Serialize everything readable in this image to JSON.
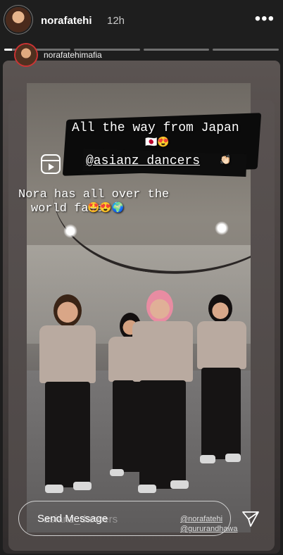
{
  "header": {
    "username": "norafatehi",
    "time_ago": "12h",
    "more_icon": "more-horizontal-icon",
    "progress": {
      "segments": 4,
      "active_index": 0,
      "active_fill_fraction": 0.12
    }
  },
  "story": {
    "shared_user": "norafatehimafia",
    "overlay_line1": "All the way from Japan",
    "overlay_flags": "🇯🇵😍",
    "overlay_mention": "@asianz_dancers",
    "overlay_clap": "👏🏻",
    "overlay_fans_line1": "Nora has all over the",
    "overlay_fans_line2": "world fans",
    "overlay_fans_emojis": "🤩😍🌍",
    "faded_caption": "asianz_dancers",
    "tag_1": "@norafatehi",
    "tag_2": "@gururandhawa"
  },
  "footer": {
    "send_placeholder": "Send Message",
    "send_icon": "paper-plane-icon"
  },
  "colors": {
    "background": "#1e1e1e",
    "progress_track": "#6f6f6f",
    "progress_fill": "#ffffff"
  }
}
